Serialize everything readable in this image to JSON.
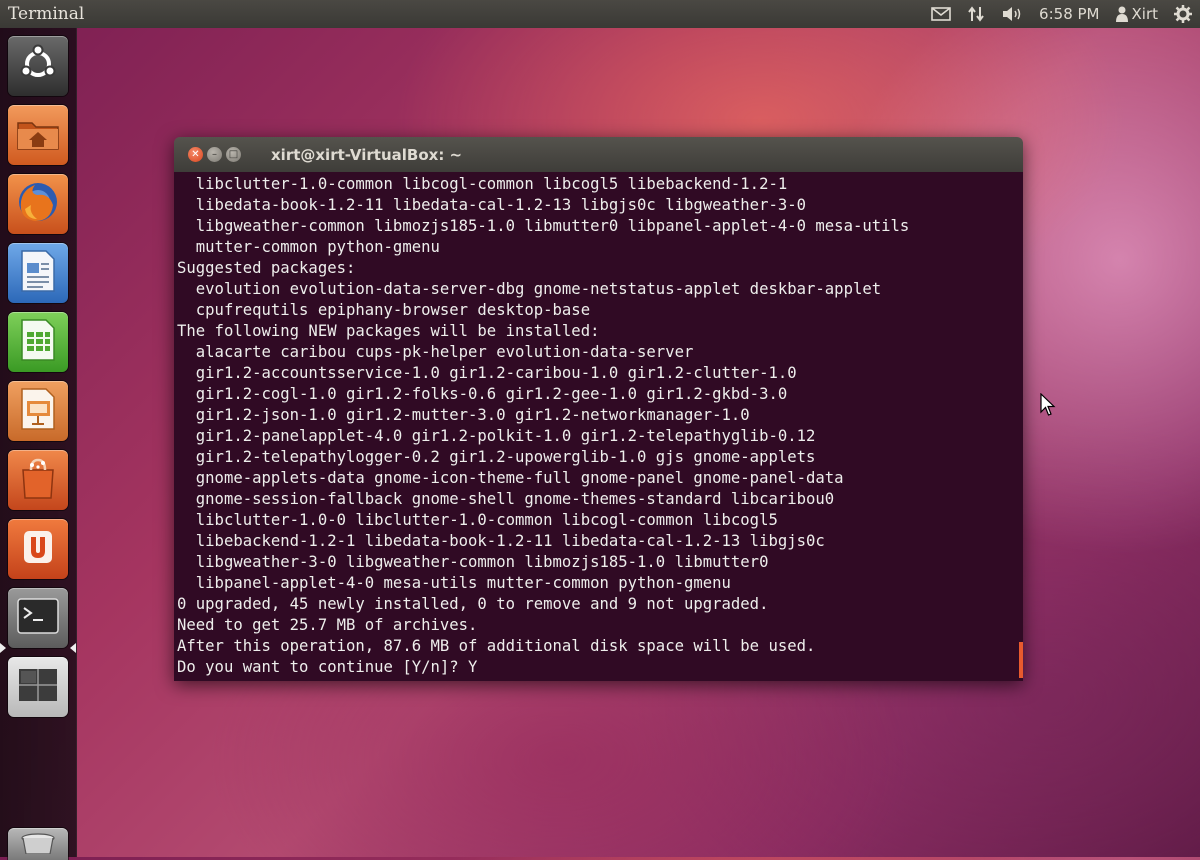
{
  "top_panel": {
    "title": "Terminal",
    "clock": "6:58 PM",
    "user": "Xirt",
    "icons": [
      "envelope-icon",
      "network-arrows-icon",
      "speaker-icon",
      "person-icon",
      "gear-icon"
    ]
  },
  "launcher": {
    "items": [
      "dash-home",
      "home-folder",
      "firefox",
      "libreoffice-writer",
      "libreoffice-calc",
      "libreoffice-impress",
      "ubuntu-software-center",
      "ubuntu-one",
      "terminal",
      "workspace-switcher",
      "trash"
    ]
  },
  "terminal": {
    "title": "xirt@xirt-VirtualBox: ~",
    "lines": [
      "  libclutter-1.0-common libcogl-common libcogl5 libebackend-1.2-1",
      "  libedata-book-1.2-11 libedata-cal-1.2-13 libgjs0c libgweather-3-0",
      "  libgweather-common libmozjs185-1.0 libmutter0 libpanel-applet-4-0 mesa-utils",
      "  mutter-common python-gmenu",
      "Suggested packages:",
      "  evolution evolution-data-server-dbg gnome-netstatus-applet deskbar-applet",
      "  cpufrequtils epiphany-browser desktop-base",
      "The following NEW packages will be installed:",
      "  alacarte caribou cups-pk-helper evolution-data-server",
      "  gir1.2-accountsservice-1.0 gir1.2-caribou-1.0 gir1.2-clutter-1.0",
      "  gir1.2-cogl-1.0 gir1.2-folks-0.6 gir1.2-gee-1.0 gir1.2-gkbd-3.0",
      "  gir1.2-json-1.0 gir1.2-mutter-3.0 gir1.2-networkmanager-1.0",
      "  gir1.2-panelapplet-4.0 gir1.2-polkit-1.0 gir1.2-telepathyglib-0.12",
      "  gir1.2-telepathylogger-0.2 gir1.2-upowerglib-1.0 gjs gnome-applets",
      "  gnome-applets-data gnome-icon-theme-full gnome-panel gnome-panel-data",
      "  gnome-session-fallback gnome-shell gnome-themes-standard libcaribou0",
      "  libclutter-1.0-0 libclutter-1.0-common libcogl-common libcogl5",
      "  libebackend-1.2-1 libedata-book-1.2-11 libedata-cal-1.2-13 libgjs0c",
      "  libgweather-3-0 libgweather-common libmozjs185-1.0 libmutter0",
      "  libpanel-applet-4-0 mesa-utils mutter-common python-gmenu",
      "0 upgraded, 45 newly installed, 0 to remove and 9 not upgraded.",
      "Need to get 25.7 MB of archives.",
      "After this operation, 87.6 MB of additional disk space will be used.",
      "Do you want to continue [Y/n]? Y"
    ]
  }
}
